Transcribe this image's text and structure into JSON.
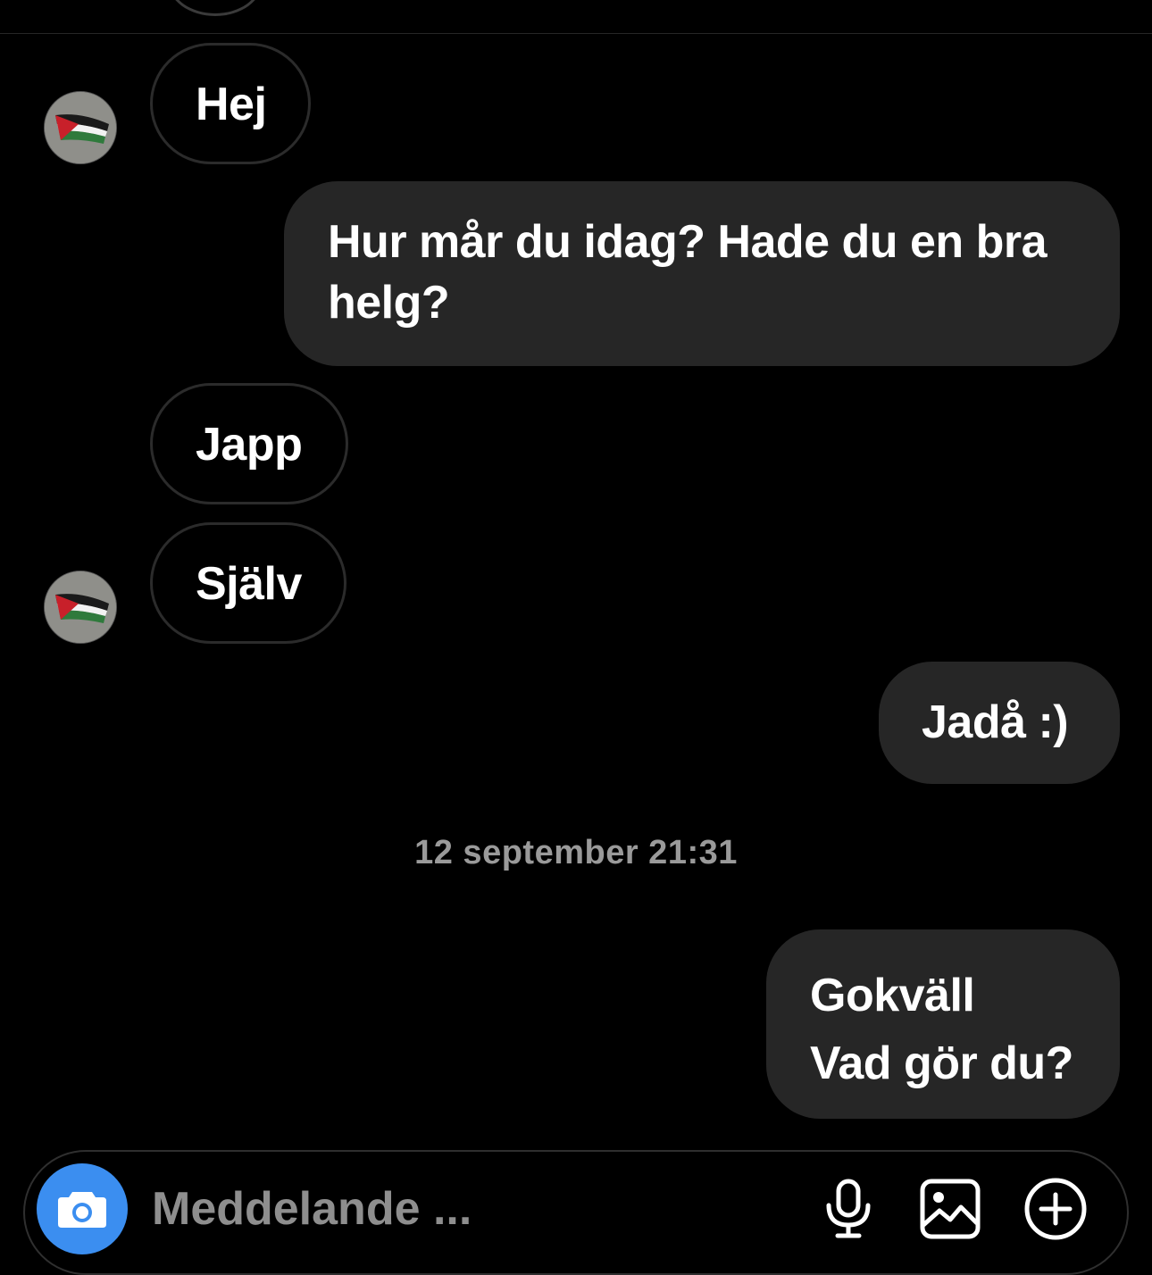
{
  "messages": [
    {
      "direction": "incoming",
      "text": "Hej"
    },
    {
      "direction": "outgoing",
      "text": "Hur mår du idag? Hade du en bra helg?"
    },
    {
      "direction": "incoming",
      "text": "Japp"
    },
    {
      "direction": "incoming",
      "text": "Själv"
    },
    {
      "direction": "outgoing",
      "text": "Jadå :)"
    },
    {
      "direction": "outgoing",
      "lines": [
        "Gokväll",
        "Vad gör du?"
      ]
    }
  ],
  "timestamp": "12 september 21:31",
  "composer": {
    "placeholder": "Meddelande ...",
    "icons": [
      "camera-icon",
      "microphone-icon",
      "image-icon",
      "plus-circle-icon"
    ],
    "camera_color": "#3b8ef0"
  },
  "avatar": {
    "icon": "palestine-flag-avatar"
  }
}
